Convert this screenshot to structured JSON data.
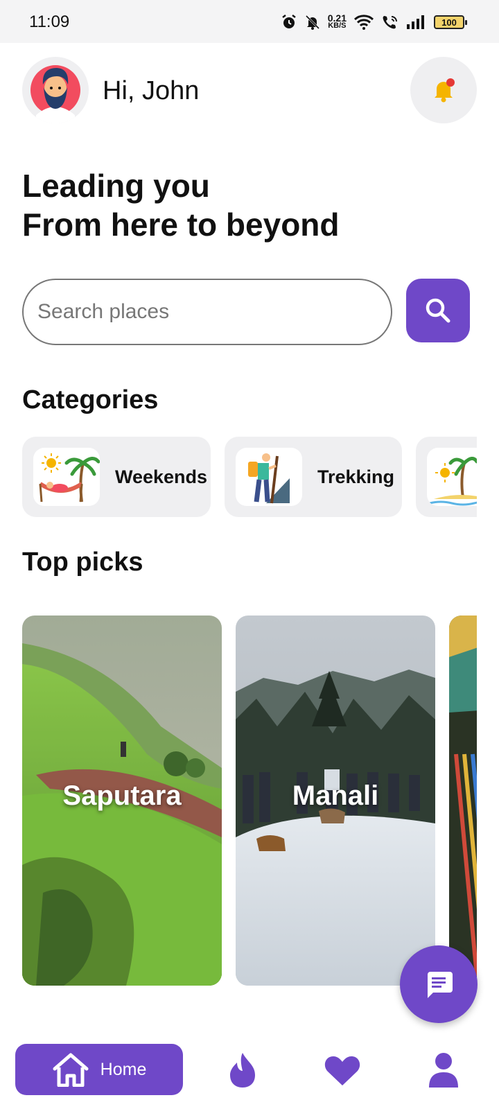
{
  "status_bar": {
    "time": "11:09",
    "speed_value": "0.21",
    "speed_unit": "KB/S",
    "battery": "100"
  },
  "header": {
    "greeting": "Hi, John"
  },
  "headline": {
    "line1": "Leading you",
    "line2": "From here to beyond"
  },
  "search": {
    "placeholder": "Search places"
  },
  "categories": {
    "title": "Categories",
    "items": [
      {
        "label": "Weekends",
        "icon": "hammock-palm-icon"
      },
      {
        "label": "Trekking",
        "icon": "hiker-icon"
      },
      {
        "label": "",
        "icon": "beach-island-icon"
      }
    ]
  },
  "top_picks": {
    "title": "Top picks",
    "items": [
      {
        "name": "Saputara"
      },
      {
        "name": "Manali"
      },
      {
        "name": ""
      }
    ]
  },
  "bottom_nav": {
    "home_label": "Home",
    "items": [
      "home-icon",
      "flame-icon",
      "heart-icon",
      "user-icon"
    ]
  },
  "colors": {
    "accent": "#6f48c8",
    "card_bg": "#efeff1",
    "notification_dot": "#e53935",
    "bell": "#f5b400"
  }
}
